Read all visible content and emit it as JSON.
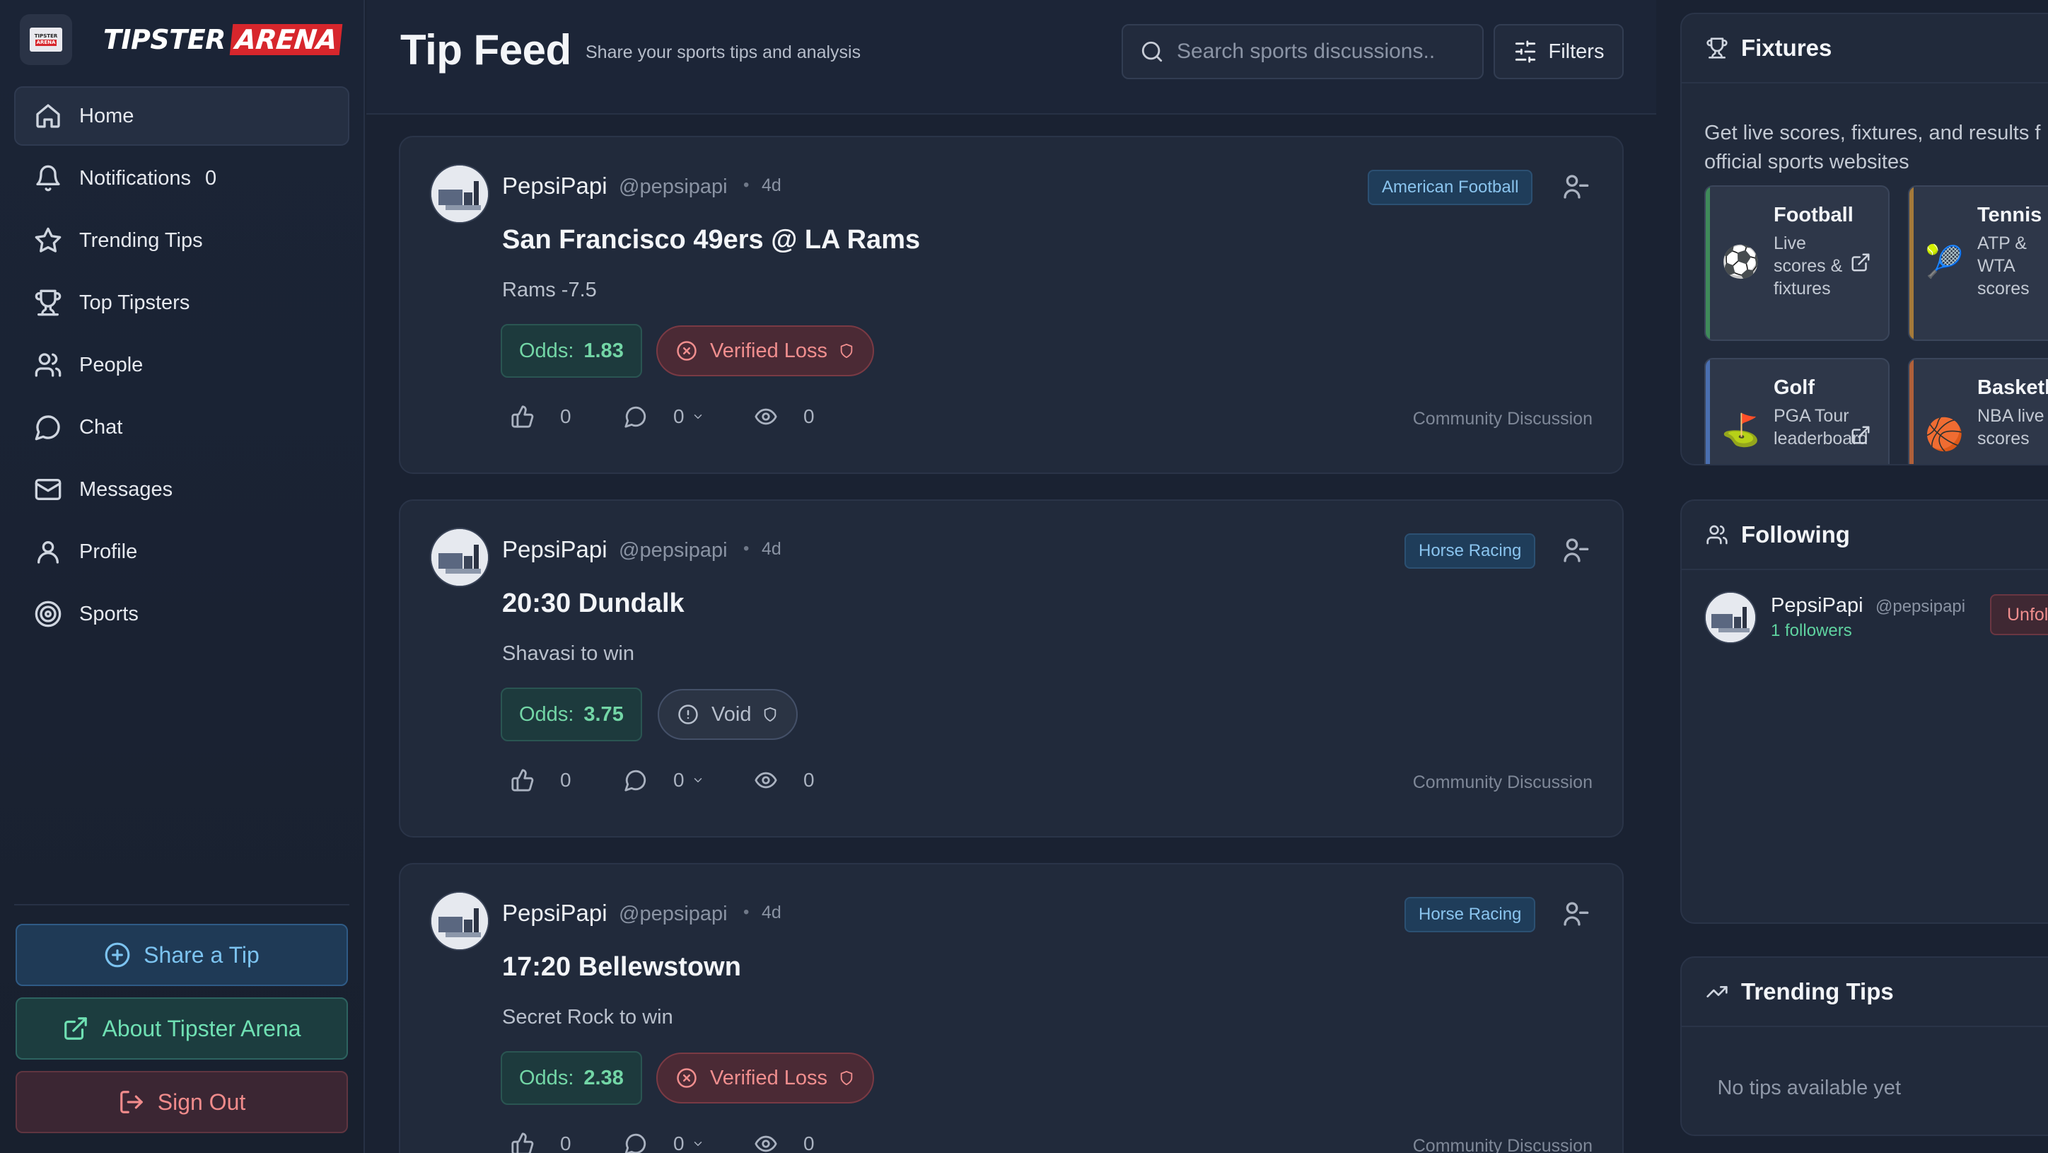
{
  "brand": {
    "badge_top": "TIPSTER",
    "badge_bottom": "ARENA",
    "word1": "TIPSTER",
    "word2": "ARENA"
  },
  "nav": [
    {
      "label": "Home",
      "icon": "home-icon",
      "active": true
    },
    {
      "label": "Notifications",
      "icon": "bell-icon",
      "count": "0"
    },
    {
      "label": "Trending Tips",
      "icon": "star-icon"
    },
    {
      "label": "Top Tipsters",
      "icon": "trophy-icon"
    },
    {
      "label": "People",
      "icon": "users-icon"
    },
    {
      "label": "Chat",
      "icon": "chat-icon"
    },
    {
      "label": "Messages",
      "icon": "mail-icon"
    },
    {
      "label": "Profile",
      "icon": "user-icon"
    },
    {
      "label": "Sports",
      "icon": "target-icon"
    }
  ],
  "sidebar_buttons": {
    "share": "Share a Tip",
    "about": "About Tipster Arena",
    "signout": "Sign Out"
  },
  "header": {
    "title": "Tip Feed",
    "subtitle": "Share your sports tips and analysis",
    "search_placeholder": "Search sports discussions..",
    "filters_label": "Filters"
  },
  "posts": [
    {
      "author": "PepsiPapi",
      "handle": "@pepsipapi",
      "age": "4d",
      "sport": "American Football",
      "title": "San Francisco 49ers @ LA Rams",
      "pick": "Rams -7.5",
      "odds_label": "Odds:",
      "odds": "1.83",
      "status": "Verified Loss",
      "status_type": "loss",
      "likes": "0",
      "comments": "0",
      "views": "0",
      "community": "Community Discussion"
    },
    {
      "author": "PepsiPapi",
      "handle": "@pepsipapi",
      "age": "4d",
      "sport": "Horse Racing",
      "title": "20:30 Dundalk",
      "pick": "Shavasi to win",
      "odds_label": "Odds:",
      "odds": "3.75",
      "status": "Void",
      "status_type": "void",
      "likes": "0",
      "comments": "0",
      "views": "0",
      "community": "Community Discussion"
    },
    {
      "author": "PepsiPapi",
      "handle": "@pepsipapi",
      "age": "4d",
      "sport": "Horse Racing",
      "title": "17:20 Bellewstown",
      "pick": "Secret Rock to win",
      "odds_label": "Odds:",
      "odds": "2.38",
      "status": "Verified Loss",
      "status_type": "loss",
      "likes": "0",
      "comments": "0",
      "views": "0",
      "community": "Community Discussion"
    }
  ],
  "fixtures": {
    "title": "Fixtures",
    "description_line1": "Get live scores, fixtures, and results f",
    "description_line2": "official sports websites",
    "cards": [
      {
        "name": "Football",
        "desc": "Live scores & fixtures",
        "emoji": "⚽",
        "color": "#3f8a5a"
      },
      {
        "name": "Tennis",
        "desc": "ATP & WTA scores",
        "emoji": "🎾",
        "color": "#a57a3a"
      },
      {
        "name": "Golf",
        "desc": "PGA Tour leaderboard",
        "emoji": "⛳",
        "color": "#4a6fb0"
      },
      {
        "name": "Basketb",
        "desc": "NBA live scores",
        "emoji": "🏀",
        "color": "#b0603a"
      }
    ]
  },
  "following": {
    "title": "Following",
    "users": [
      {
        "name": "PepsiPapi",
        "handle": "@pepsipapi",
        "followers": "1 followers",
        "action": "Unfol"
      }
    ]
  },
  "trending": {
    "title": "Trending Tips",
    "empty": "No tips available yet"
  }
}
